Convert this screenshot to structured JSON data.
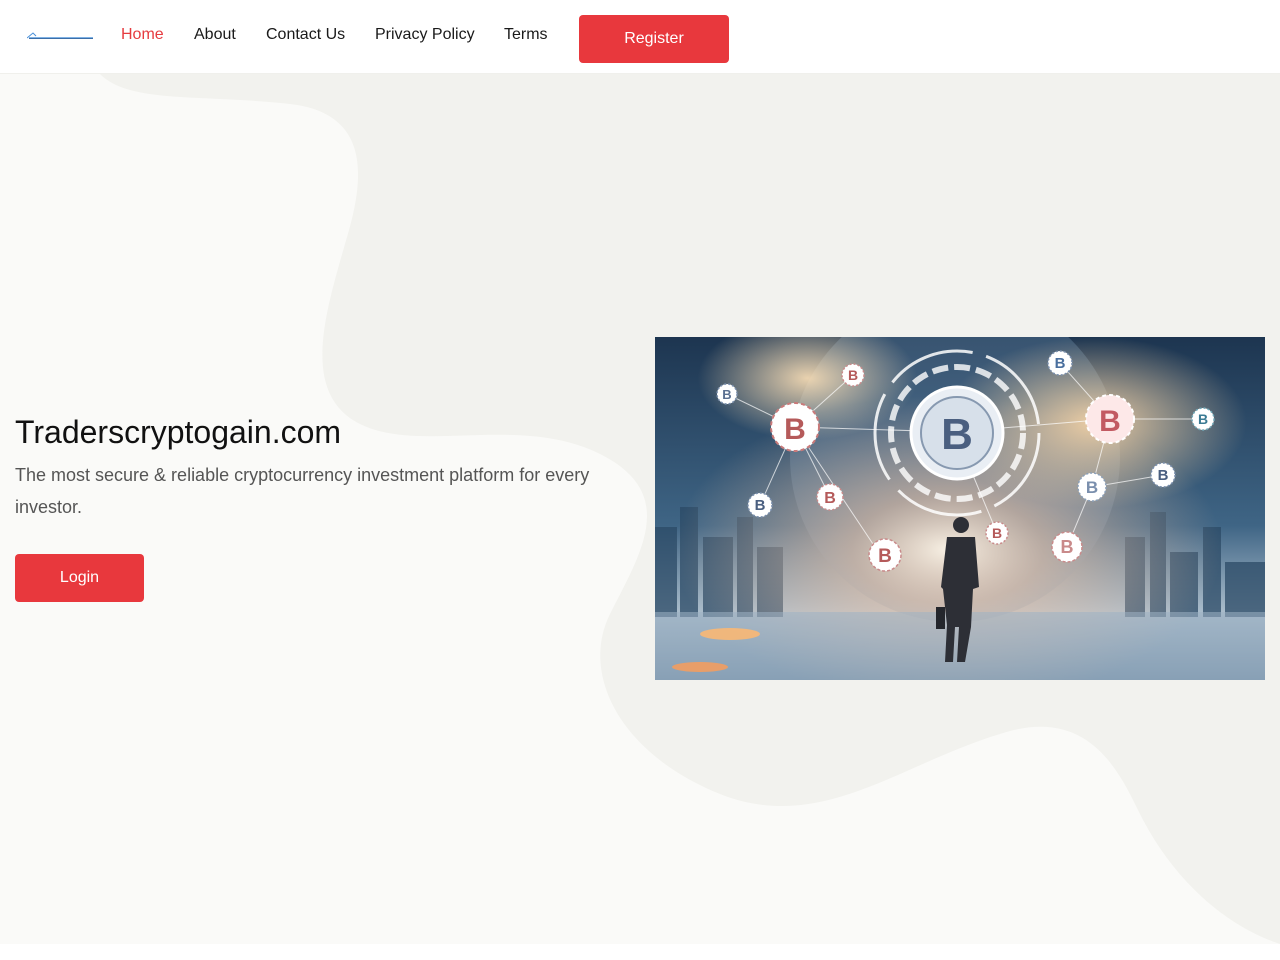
{
  "header": {
    "logo_alt": "Traderscryptogain",
    "nav": [
      "Home",
      "About",
      "Contact Us",
      "Privacy Policy",
      "Terms"
    ],
    "active_nav": "Home",
    "register_label": "Register"
  },
  "hero": {
    "title": "Traderscryptogain.com",
    "subtitle": "The most secure & reliable cryptocurrency investment platform for every investor.",
    "login_label": "Login",
    "image_icon": "bitcoin-network-businessman-illustration"
  },
  "colors": {
    "accent": "#e8383d",
    "hero_bg": "#f2f2ee",
    "blob": "#fafaf8"
  }
}
